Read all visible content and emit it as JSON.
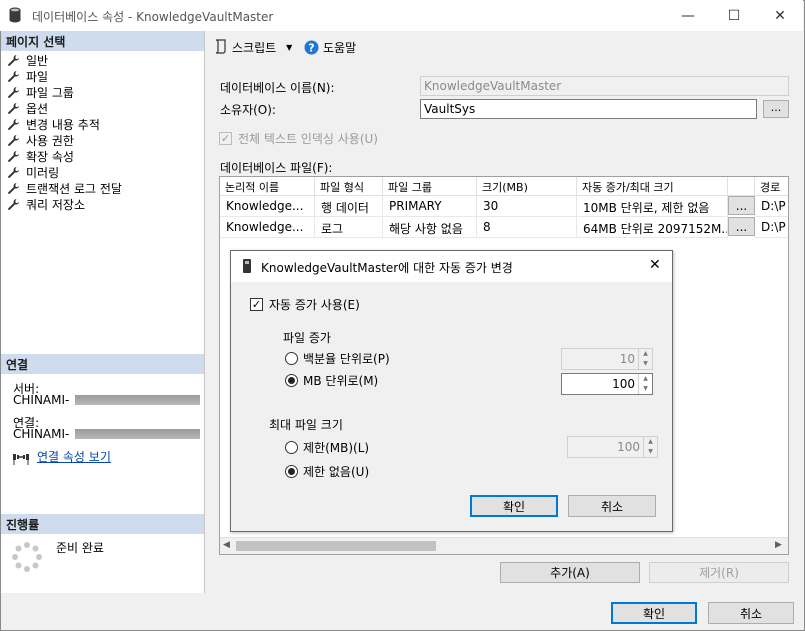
{
  "window": {
    "title": "데이터베이스 속성 - KnowledgeVaultMaster",
    "minimize_glyph": "—",
    "maximize_glyph": "☐",
    "close_glyph": "✕"
  },
  "left_pane": {
    "page_select_header": "페이지 선택",
    "pages": [
      "일반",
      "파일",
      "파일 그룹",
      "옵션",
      "변경 내용 추적",
      "사용 권한",
      "확장 속성",
      "미러링",
      "트랜잭션 로그 전달",
      "쿼리 저장소"
    ],
    "connection_header": "연결",
    "server_label": "서버:",
    "server_value": "CHINAMI-",
    "connection_label": "연결:",
    "connection_value": "CHINAMI-",
    "view_connection_props": "연결 속성 보기",
    "progress_header": "진행률",
    "progress_status": "준비 완료"
  },
  "toolbar": {
    "script_label": "스크립트",
    "help_label": "도움말"
  },
  "form": {
    "db_name_label": "데이터베이스 이름(N):",
    "db_name_value": "KnowledgeVaultMaster",
    "owner_label": "소유자(O):",
    "owner_value": "VaultSys",
    "owner_browse": "...",
    "fulltext_label": "전체 텍스트 인덱싱 사용(U)",
    "db_files_label": "데이터베이스 파일(F):"
  },
  "grid": {
    "columns": [
      "논리적 이름",
      "파일 형식",
      "파일 그룹",
      "크기(MB)",
      "자동 증가/최대 크기",
      "",
      "경로"
    ],
    "rows": [
      [
        "Knowledge...",
        "행 데이터",
        "PRIMARY",
        "30",
        "10MB 단위로, 제한 없음",
        "...",
        "D:\\P"
      ],
      [
        "Knowledge...",
        "로그",
        "해당 사항 없음",
        "8",
        "64MB 단위로 2097152M...",
        "...",
        "D:\\P"
      ]
    ]
  },
  "buttons": {
    "add": "추가(A)",
    "remove": "제거(R)",
    "ok": "확인",
    "cancel": "취소"
  },
  "dialog": {
    "title": "KnowledgeVaultMaster에 대한 자동 증가 변경",
    "enable_autogrowth": "자동 증가 사용(E)",
    "file_growth_label": "파일 증가",
    "percent_label": "백분율 단위로(P)",
    "percent_value": "10",
    "mb_label": "MB 단위로(M)",
    "mb_value": "100",
    "max_size_label": "최대 파일 크기",
    "limited_label": "제한(MB)(L)",
    "limited_value": "100",
    "unlimited_label": "제한 없음(U)",
    "ok": "확인",
    "cancel": "취소",
    "close_glyph": "✕"
  }
}
